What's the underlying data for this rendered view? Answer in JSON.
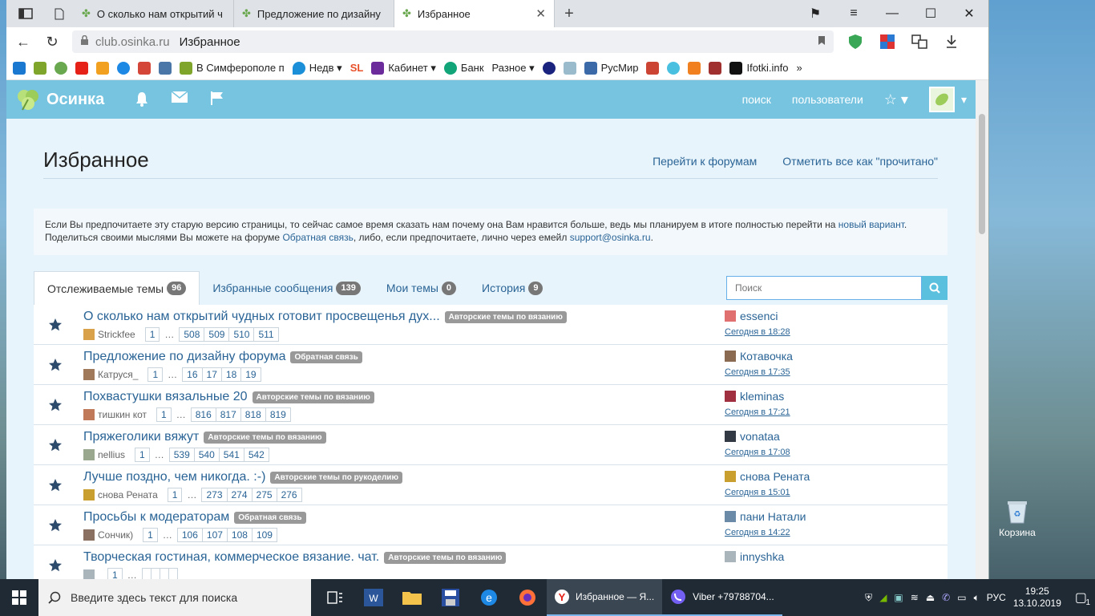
{
  "browser": {
    "tabs": [
      {
        "label": "О сколько нам открытий ч",
        "active": false
      },
      {
        "label": "Предложение по дизайну",
        "active": false
      },
      {
        "label": "Избранное",
        "active": true
      }
    ],
    "address": {
      "domain": "club.osinka.ru",
      "page": "Избранное"
    },
    "bookmarks": [
      {
        "label": "В Симферополе п",
        "color": "#7fa52a"
      },
      {
        "label": "Недв ▾",
        "color": "#1b8fd8"
      },
      {
        "label": "Кабинет ▾",
        "color": "#6b2b9a"
      },
      {
        "label": "Банк",
        "color": "#12a57a"
      },
      {
        "label": "Разное ▾",
        "color": "#888888"
      },
      {
        "label": "РусМир",
        "color": "#3c6aa8"
      },
      {
        "label": "Ifotki.info",
        "color": "#111111"
      }
    ]
  },
  "site": {
    "logo": "Осинка",
    "nav": {
      "search": "поиск",
      "users": "пользователи"
    },
    "page_title": "Избранное",
    "title_links": {
      "forums": "Перейти к форумам",
      "mark_read": "Отметить все как \"прочитано\""
    },
    "notice": {
      "line1_pre": "Если Вы предпочитаете эту старую версию страницы, то сейчас самое время сказать нам почему она Вам нравится больше, ведь мы планируем в итоге полностью перейти на ",
      "line1_link": "новый вариант",
      "line1_post": ".",
      "line2_pre": "Поделиться своими мыслями Вы можете на форуме ",
      "line2_link": "Обратная связь",
      "line2_mid": ", либо, если предпочитаете, лично через емейл ",
      "line2_email": "support@osinka.ru",
      "line2_post": "."
    },
    "tabs": [
      {
        "label": "Отслеживаемые темы",
        "count": "96"
      },
      {
        "label": "Избранные сообщения",
        "count": "139"
      },
      {
        "label": "Мои темы",
        "count": "0"
      },
      {
        "label": "История",
        "count": "9"
      }
    ],
    "search_placeholder": "Поиск",
    "topics": [
      {
        "title": "О сколько нам открытий чудных готовит просвещенья дух...",
        "category": "Авторские темы по вязанию",
        "author": "Strickfee",
        "pages": [
          "508",
          "509",
          "510",
          "511"
        ],
        "last_user": "essenci",
        "last_time": "Сегодня в 18:28",
        "ava": "#d9a24a",
        "lava": "#e07070"
      },
      {
        "title": "Предложение по дизайну форума",
        "category": "Обратная связь",
        "author": "Катруся_",
        "pages": [
          "16",
          "17",
          "18",
          "19"
        ],
        "last_user": "Котавочка",
        "last_time": "Сегодня в 17:35",
        "ava": "#a0785a",
        "lava": "#8a6a50"
      },
      {
        "title": "Похвастушки вязальные 20",
        "category": "Авторские темы по вязанию",
        "author": "тишкин кот",
        "pages": [
          "816",
          "817",
          "818",
          "819"
        ],
        "last_user": "kleminas",
        "last_time": "Сегодня в 17:21",
        "ava": "#c07a5a",
        "lava": "#a03040"
      },
      {
        "title": "Пряжеголики вяжут",
        "category": "Авторские темы по вязанию",
        "author": "nellius",
        "pages": [
          "539",
          "540",
          "541",
          "542"
        ],
        "last_user": "vonataa",
        "last_time": "Сегодня в 17:08",
        "ava": "#9aa890",
        "lava": "#333a44"
      },
      {
        "title": "Лучше поздно, чем никогда. :-)",
        "category": "Авторские темы по рукоделию",
        "author": "снова Рената",
        "pages": [
          "273",
          "274",
          "275",
          "276"
        ],
        "last_user": "снова Рената",
        "last_time": "Сегодня в 15:01",
        "ava": "#c9a030",
        "lava": "#c9a030"
      },
      {
        "title": "Просьбы к модераторам",
        "category": "Обратная связь",
        "author": "Сончик)",
        "pages": [
          "106",
          "107",
          "108",
          "109"
        ],
        "last_user": "пани Натали",
        "last_time": "Сегодня в 14:22",
        "ava": "#8a7060",
        "lava": "#6a8aa8"
      },
      {
        "title": "Творческая гостиная, коммерческое вязание. чат.",
        "category": "Авторские темы по вязанию",
        "author": "",
        "pages": [
          "",
          "",
          "",
          ""
        ],
        "last_user": "innyshka",
        "last_time": "",
        "ava": "#aab4bb",
        "lava": "#aab4bb"
      }
    ],
    "first_page": "1",
    "ellipsis": "…"
  },
  "desktop": {
    "recycle_label": "Корзина"
  },
  "taskbar": {
    "search_placeholder": "Введите здесь текст для поиска",
    "app_yandex": "Избранное — Я...",
    "app_viber": "Viber +79788704...",
    "lang": "РУС",
    "time": "19:25",
    "date": "13.10.2019",
    "notifications": "1"
  },
  "colors": {
    "header": "#76c4e0",
    "link": "#2a6496",
    "content_bg": "#e8f4fb",
    "taskbar": "#1f2a35"
  }
}
